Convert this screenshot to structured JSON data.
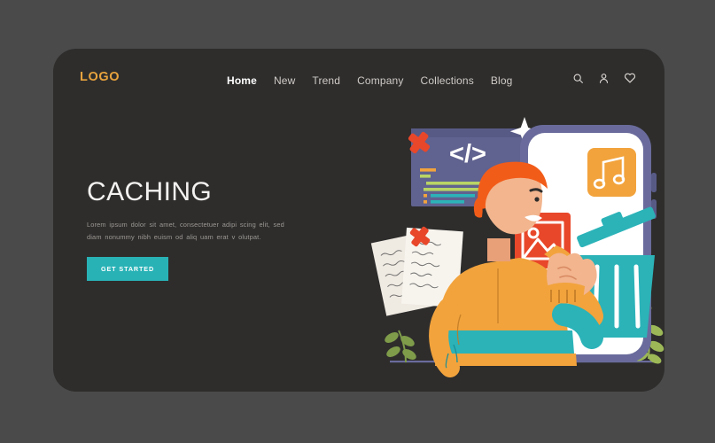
{
  "theme": {
    "page_background": "#4a4a4a",
    "card_background": "#2e2d2c",
    "logo_color": "#e8a33d",
    "accent_color": "#28b2b6",
    "heading_color": "#f4f2f0",
    "body_text_color": "#9c9893",
    "illustration_orange": "#f2a33c",
    "illustration_red": "#e8472a",
    "illustration_teal": "#2bb3b8",
    "illustration_purple": "#6a6b9c",
    "illustration_green": "#a8c martins"
  },
  "header": {
    "logo": "LOGO",
    "nav": [
      {
        "label": "Home",
        "active": true
      },
      {
        "label": "New",
        "active": false
      },
      {
        "label": "Trend",
        "active": false
      },
      {
        "label": "Company",
        "active": false
      },
      {
        "label": "Collections",
        "active": false
      },
      {
        "label": "Blog",
        "active": false
      }
    ],
    "icons": [
      {
        "name": "search-icon",
        "glyph": "magnifier"
      },
      {
        "name": "user-icon",
        "glyph": "person"
      },
      {
        "name": "heart-icon",
        "glyph": "heart"
      }
    ]
  },
  "hero": {
    "title": "CACHING",
    "body_line_1": "Lorem ipsum dolor sit amet, consectetuer adipi       scing elit,   sed",
    "body_line_2": "diam nonummy nibh euism    od aliq uam  erat v olutpat.",
    "cta_label": "GET STARTED"
  },
  "illustration": {
    "description": "Flat vector illustration of a person with orange hair holding papers, deleting files on a large smartphone into a trash can",
    "elements": [
      {
        "name": "code-window",
        "label": "</>"
      },
      {
        "name": "x-mark-window",
        "label": "X"
      },
      {
        "name": "x-mark-papers",
        "label": "X"
      },
      {
        "name": "papers-stack",
        "label": ""
      },
      {
        "name": "smartphone",
        "label": ""
      },
      {
        "name": "music-app-icon",
        "label": "music-note"
      },
      {
        "name": "image-app-icon",
        "label": "picture"
      },
      {
        "name": "trash-can",
        "label": ""
      },
      {
        "name": "character",
        "label": ""
      },
      {
        "name": "sparkle-top",
        "label": ""
      },
      {
        "name": "sparkle-right",
        "label": ""
      },
      {
        "name": "plant-left",
        "label": ""
      },
      {
        "name": "plant-right",
        "label": ""
      }
    ]
  }
}
